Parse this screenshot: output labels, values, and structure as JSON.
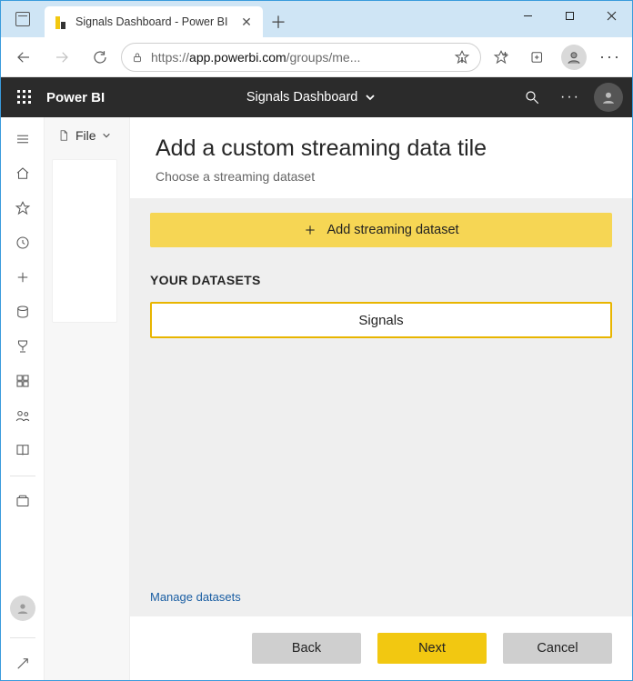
{
  "browser": {
    "tab_title": "Signals Dashboard - Power BI",
    "url_display_prefix": "https://",
    "url_display_host": "app.powerbi.com",
    "url_display_path": "/groups/me..."
  },
  "pbi": {
    "brand": "Power BI",
    "dashboard_name": "Signals Dashboard"
  },
  "file_menu_label": "File",
  "panel": {
    "title": "Add a custom streaming data tile",
    "subtitle": "Choose a streaming dataset",
    "add_dataset_label": "Add streaming dataset",
    "your_datasets_label": "YOUR DATASETS",
    "datasets": [
      {
        "name": "Signals"
      }
    ],
    "manage_link": "Manage datasets",
    "buttons": {
      "back": "Back",
      "next": "Next",
      "cancel": "Cancel"
    }
  }
}
